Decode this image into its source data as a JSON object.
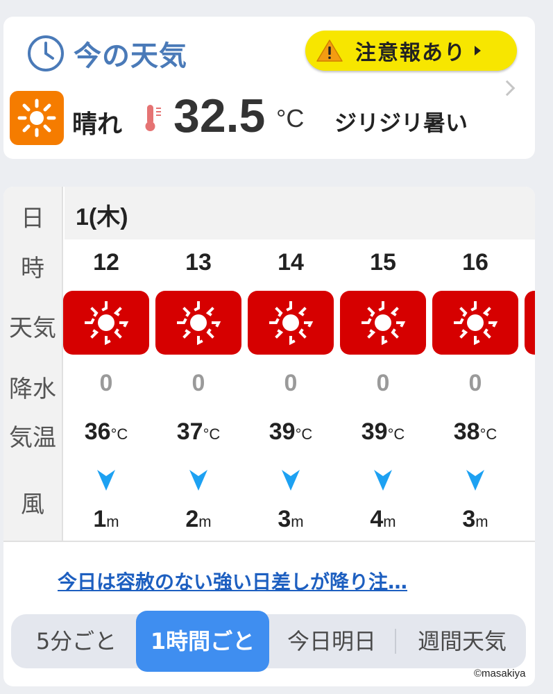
{
  "current": {
    "title": "今の天気",
    "alert_label": "注意報あり",
    "condition": "晴れ",
    "temperature": "32.5",
    "unit": "°C",
    "heat_description": "ジリジリ暑い"
  },
  "hourly": {
    "labels": {
      "date": "日",
      "time": "時",
      "weather": "天気",
      "precip": "降水",
      "temp": "気温",
      "wind": "風"
    },
    "date": "1(木)",
    "temp_unit": "°C",
    "wind_unit": "m",
    "hours": [
      {
        "hour": "12",
        "weather": "sunny-icon",
        "precip": "0",
        "temp": "36",
        "wind_speed": "1",
        "wind_direction": "north"
      },
      {
        "hour": "13",
        "weather": "sunny-icon",
        "precip": "0",
        "temp": "37",
        "wind_speed": "2",
        "wind_direction": "north"
      },
      {
        "hour": "14",
        "weather": "sunny-icon",
        "precip": "0",
        "temp": "39",
        "wind_speed": "3",
        "wind_direction": "north"
      },
      {
        "hour": "15",
        "weather": "sunny-icon",
        "precip": "0",
        "temp": "39",
        "wind_speed": "4",
        "wind_direction": "north"
      },
      {
        "hour": "16",
        "weather": "sunny-icon",
        "precip": "0",
        "temp": "38",
        "wind_speed": "3",
        "wind_direction": "north"
      }
    ],
    "comment": "今日は容赦のない強い日差しが降り注…"
  },
  "tabs": [
    {
      "label": "5分ごと",
      "active": false
    },
    {
      "label": "1時間ごと",
      "active": true
    },
    {
      "label": "今日明日",
      "active": false
    },
    {
      "label": "週間天気",
      "active": false
    }
  ],
  "credit": "©masakiya",
  "colors": {
    "title_blue": "#4a7ab8",
    "alert_yellow": "#f7e600",
    "sun_orange": "#f57c00",
    "weather_tile_red": "#d60000",
    "wind_arrow": "#1da1f2",
    "link_blue": "#1d5fc0",
    "tab_active": "#3f8ef0"
  }
}
